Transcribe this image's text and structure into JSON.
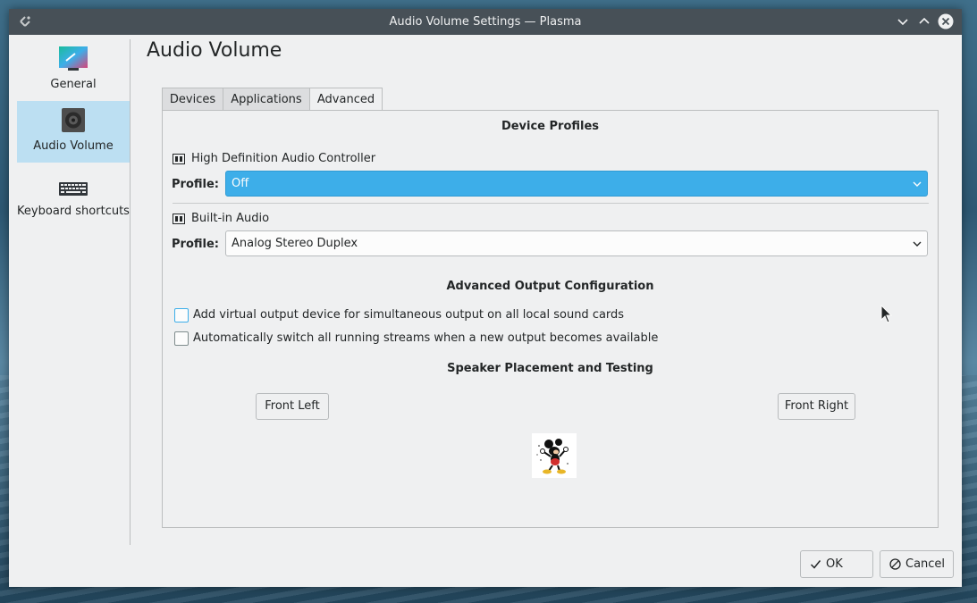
{
  "window": {
    "title": "Audio Volume Settings — Plasma"
  },
  "sidebar": {
    "items": [
      {
        "label": "General",
        "icon": "general-icon"
      },
      {
        "label": "Audio Volume",
        "icon": "speaker-icon"
      },
      {
        "label": "Keyboard shortcuts",
        "icon": "keyboard-icon"
      }
    ]
  },
  "page": {
    "title": "Audio Volume"
  },
  "tabs": [
    "Devices",
    "Applications",
    "Advanced"
  ],
  "advanced": {
    "device_profiles_title": "Device Profiles",
    "devices": [
      {
        "name": "High Definition Audio Controller",
        "profile_label": "Profile:",
        "profile_value": "Off"
      },
      {
        "name": "Built-in Audio",
        "profile_label": "Profile:",
        "profile_value": "Analog Stereo Duplex"
      }
    ],
    "output_config_title": "Advanced Output Configuration",
    "options": [
      {
        "label": "Add virtual output device for simultaneous output on all local sound cards",
        "checked": false
      },
      {
        "label": "Automatically switch all running streams when a new output becomes available",
        "checked": false
      }
    ],
    "speaker_title": "Speaker Placement and Testing",
    "front_left": "Front Left",
    "front_right": "Front Right"
  },
  "footer": {
    "ok": "OK",
    "cancel": "Cancel"
  },
  "colors": {
    "accent": "#3daee9",
    "titlebar": "#475057",
    "selection": "#bcdff2"
  }
}
